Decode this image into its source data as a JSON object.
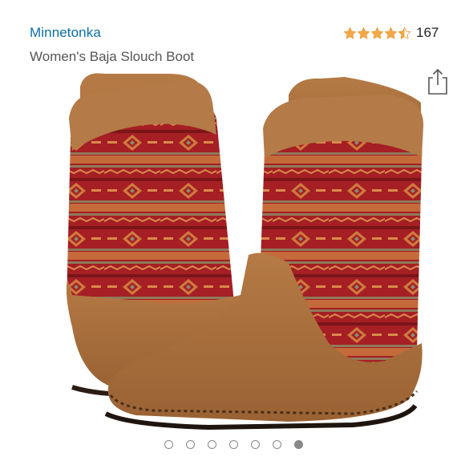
{
  "product": {
    "brand": "Minnetonka",
    "title": "Women's Baja Slouch Boot"
  },
  "rating": {
    "stars": 4.5,
    "count": "167"
  },
  "icons": {
    "share": "share-icon",
    "star": "star-icon"
  },
  "colors": {
    "brand_link": "#0b6fa8",
    "star": "#f3a847",
    "suede": "#a9713f",
    "tapestry_red": "#a51f24"
  },
  "carousel": {
    "total": 7,
    "active_index": 6
  }
}
